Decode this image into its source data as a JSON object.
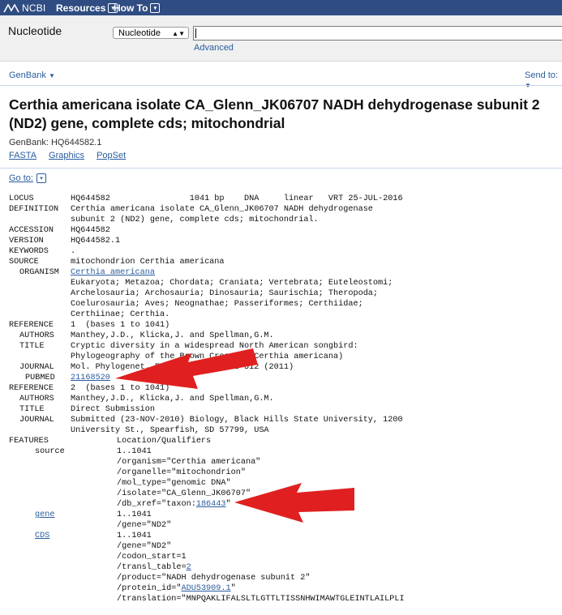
{
  "header": {
    "logo_text": "NCBI",
    "nav": [
      {
        "label": "Resources"
      },
      {
        "label": "How To"
      }
    ]
  },
  "search": {
    "database_title": "Nucleotide",
    "selected_db": "Nucleotide",
    "query": "",
    "advanced_label": "Advanced"
  },
  "toolbar": {
    "format_label": "GenBank",
    "send_to_label": "Send to:"
  },
  "record": {
    "title": "Certhia americana isolate CA_Glenn_JK06707 NADH dehydrogenase subunit 2 (ND2) gene, complete cds; mitochondrial",
    "accession_line": "GenBank: HQ644582.1",
    "links": [
      "FASTA",
      "Graphics",
      "PopSet"
    ],
    "goto_label": "Go to:"
  },
  "genbank": {
    "locus_line": "HQ644582                1041 bp    DNA     linear   VRT 25-JUL-2016",
    "definition": [
      "Certhia americana isolate CA_Glenn_JK06707 NADH dehydrogenase",
      "subunit 2 (ND2) gene, complete cds; mitochondrial."
    ],
    "accession": "HQ644582",
    "version": "HQ644582.1",
    "keywords": ".",
    "source": "mitochondrion Certhia americana",
    "organism_link": "Certhia americana",
    "taxonomy": [
      "Eukaryota; Metazoa; Chordata; Craniata; Vertebrata; Euteleostomi;",
      "Archelosauria; Archosauria; Dinosauria; Saurischia; Theropoda;",
      "Coelurosauria; Aves; Neognathae; Passeriformes; Certhiidae;",
      "Certhiinae; Certhia."
    ],
    "ref1": {
      "label": "1  (bases 1 to 1041)",
      "authors": "Manthey,J.D., Klicka,J. and Spellman,G.M.",
      "title": [
        "Cryptic diversity in a widespread North American songbird:",
        "Phylogeography of the Brown Creeper (Certhia americana)"
      ],
      "journal": "Mol. Phylogenet. Evol. 58 (3), 502-512 (2011)",
      "pubmed": "21168520"
    },
    "ref2": {
      "label": "2  (bases 1 to 1041)",
      "authors": "Manthey,J.D., Klicka,J. and Spellman,G.M.",
      "title": "Direct Submission",
      "journal": [
        "Submitted (23-NOV-2010) Biology, Black Hills State University, 1200",
        "University St., Spearfish, SD 57799, USA"
      ]
    },
    "features_header": "Location/Qualifiers",
    "source_feature": {
      "location": "1..1041",
      "qualifiers": [
        "/organism=\"Certhia americana\"",
        "/organelle=\"mitochondrion\"",
        "/mol_type=\"genomic DNA\"",
        "/isolate=\"CA_Glenn_JK06707\""
      ],
      "db_xref_prefix": "/db_xref=\"taxon:",
      "taxon_id": "186443",
      "db_xref_suffix": "\""
    },
    "gene_feature": {
      "key": "gene",
      "location": "1..1041",
      "qualifier": "/gene=\"ND2\""
    },
    "cds_feature": {
      "key": "CDS",
      "location": "1..1041",
      "gene": "/gene=\"ND2\"",
      "codon_start": "/codon_start=1",
      "transl_prefix": "/transl_table=",
      "transl_value": "2",
      "product": "/product=\"NADH dehydrogenase subunit 2\"",
      "protein_prefix": "/protein_id=\"",
      "protein_id": "ADU53909.1",
      "protein_suffix": "\"",
      "translation": "/translation=\"MNPQAKLIFALSLTLGTTLTISSNHWIMAWTGLEINTLAILPLI"
    },
    "keys": {
      "locus": "LOCUS",
      "definition": "DEFINITION",
      "accession": "ACCESSION",
      "version": "VERSION",
      "keywords": "KEYWORDS",
      "source": "SOURCE",
      "organism": "ORGANISM",
      "reference": "REFERENCE",
      "authors": "AUTHORS",
      "title": "TITLE",
      "journal": "JOURNAL",
      "pubmed": "PUBMED",
      "features": "FEATURES",
      "source_key": "source"
    }
  },
  "colors": {
    "topbar": "#2f4d82",
    "link": "#2a5d9e",
    "arrow": "#e02020"
  }
}
